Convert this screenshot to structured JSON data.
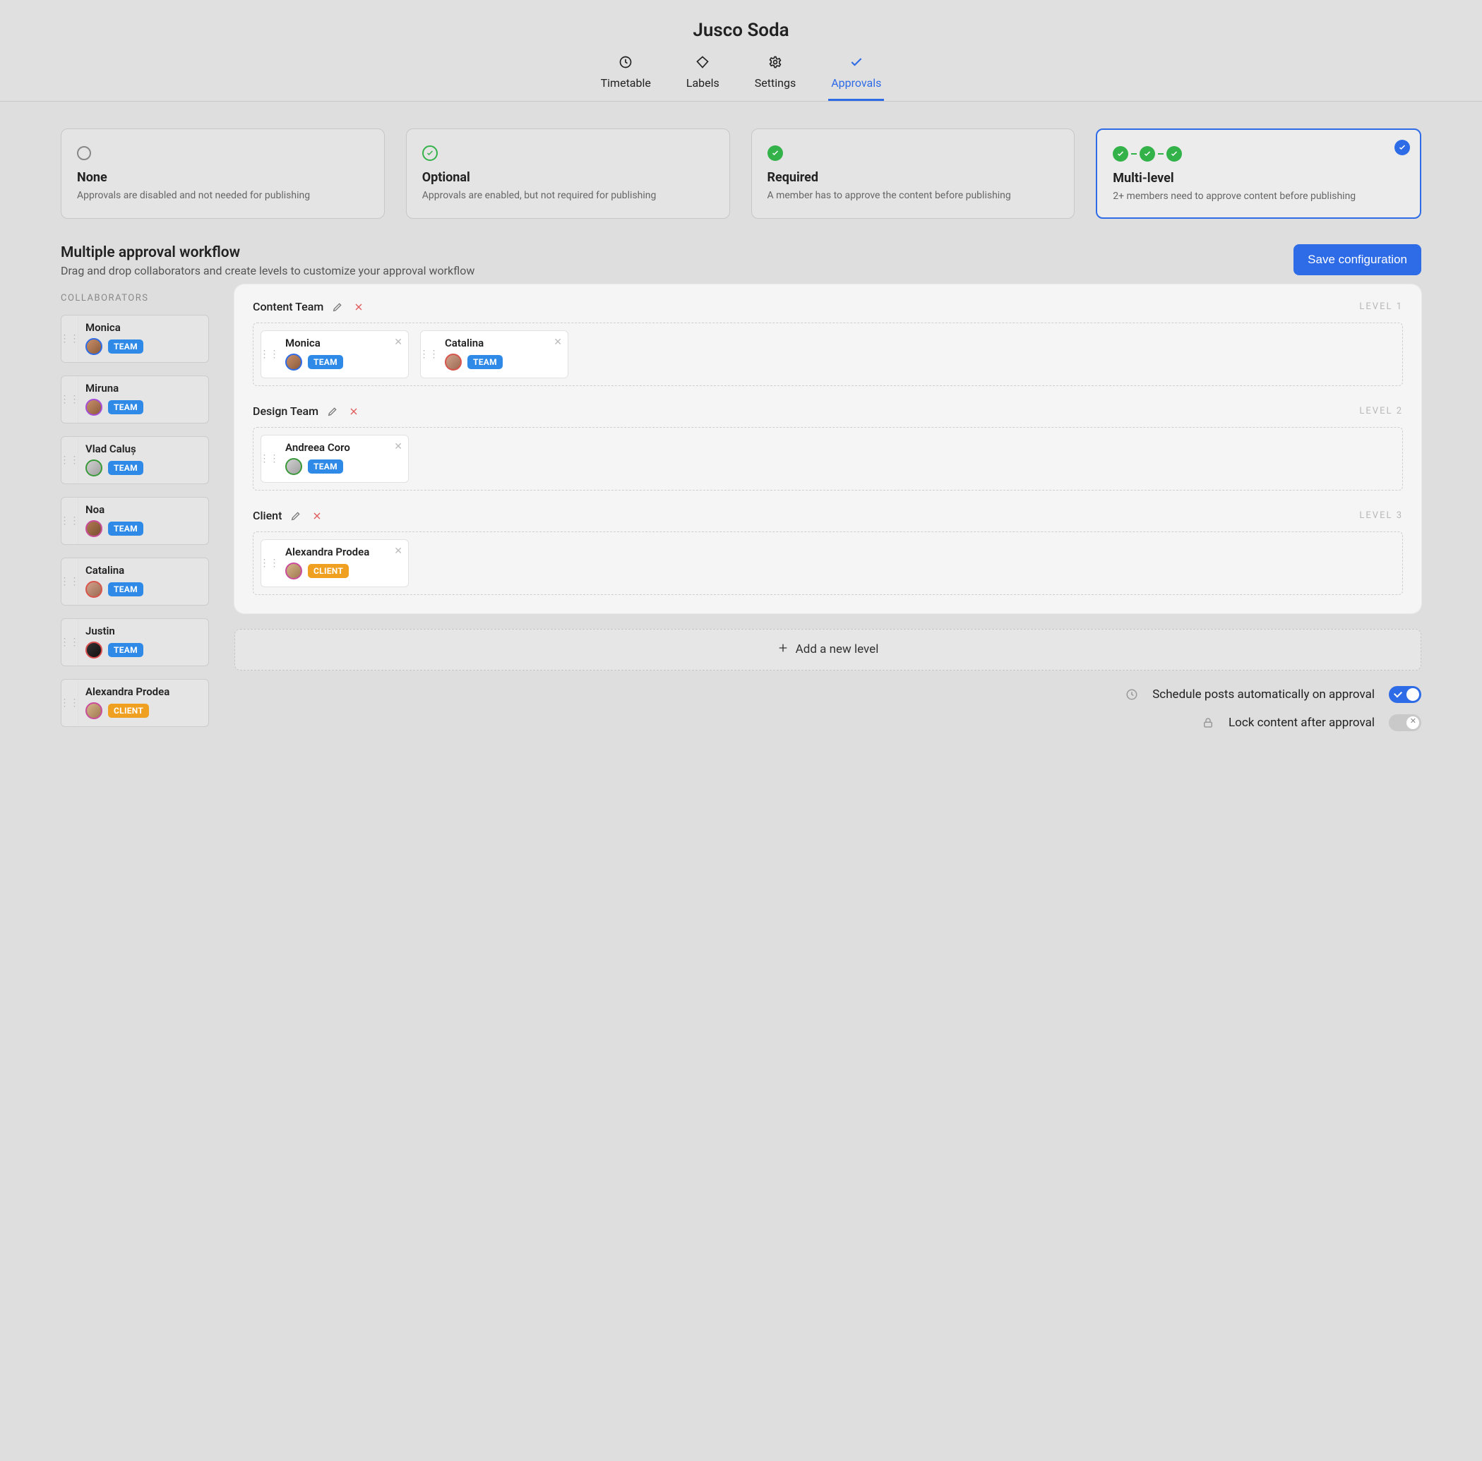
{
  "header": {
    "title": "Jusco Soda",
    "tabs": [
      {
        "id": "timetable",
        "label": "Timetable",
        "active": false
      },
      {
        "id": "labels",
        "label": "Labels",
        "active": false
      },
      {
        "id": "settings",
        "label": "Settings",
        "active": false
      },
      {
        "id": "approvals",
        "label": "Approvals",
        "active": true
      }
    ]
  },
  "approval_modes": [
    {
      "id": "none",
      "title": "None",
      "desc": "Approvals are disabled and not needed for publishing",
      "selected": false
    },
    {
      "id": "optional",
      "title": "Optional",
      "desc": "Approvals are enabled, but not required for publishing",
      "selected": false
    },
    {
      "id": "required",
      "title": "Required",
      "desc": "A member has to approve the content before publishing",
      "selected": false
    },
    {
      "id": "multi",
      "title": "Multi-level",
      "desc": "2+ members need to approve content before publishing",
      "selected": true
    }
  ],
  "workflow": {
    "title": "Multiple approval workflow",
    "subtitle": "Drag and drop collaborators and create levels to customize your approval workflow",
    "save_label": "Save configuration",
    "collaborators_heading": "COLLABORATORS",
    "add_level_label": "Add a new level"
  },
  "collaborators": [
    {
      "name": "Monica",
      "role": "TEAM",
      "avatar": "c7"
    },
    {
      "name": "Miruna",
      "role": "TEAM",
      "avatar": ""
    },
    {
      "name": "Vlad Caluș",
      "role": "TEAM",
      "avatar": "c3"
    },
    {
      "name": "Noa",
      "role": "TEAM",
      "avatar": "c4"
    },
    {
      "name": "Catalina",
      "role": "TEAM",
      "avatar": "c2"
    },
    {
      "name": "Justin",
      "role": "TEAM",
      "avatar": "c5"
    },
    {
      "name": "Alexandra Prodea",
      "role": "CLIENT",
      "avatar": "c6"
    }
  ],
  "levels": [
    {
      "name": "Content Team",
      "label": "LEVEL 1",
      "members": [
        {
          "name": "Monica",
          "role": "TEAM",
          "avatar": "c7"
        },
        {
          "name": "Catalina",
          "role": "TEAM",
          "avatar": "c2"
        }
      ]
    },
    {
      "name": "Design Team",
      "label": "LEVEL 2",
      "members": [
        {
          "name": "Andreea Coro",
          "role": "TEAM",
          "avatar": "c3"
        }
      ]
    },
    {
      "name": "Client",
      "label": "LEVEL 3",
      "members": [
        {
          "name": "Alexandra Prodea",
          "role": "CLIENT",
          "avatar": "c6"
        }
      ]
    }
  ],
  "settings": {
    "schedule_label": "Schedule posts automatically on approval",
    "schedule_on": true,
    "lock_label": "Lock content after approval",
    "lock_on": false
  }
}
